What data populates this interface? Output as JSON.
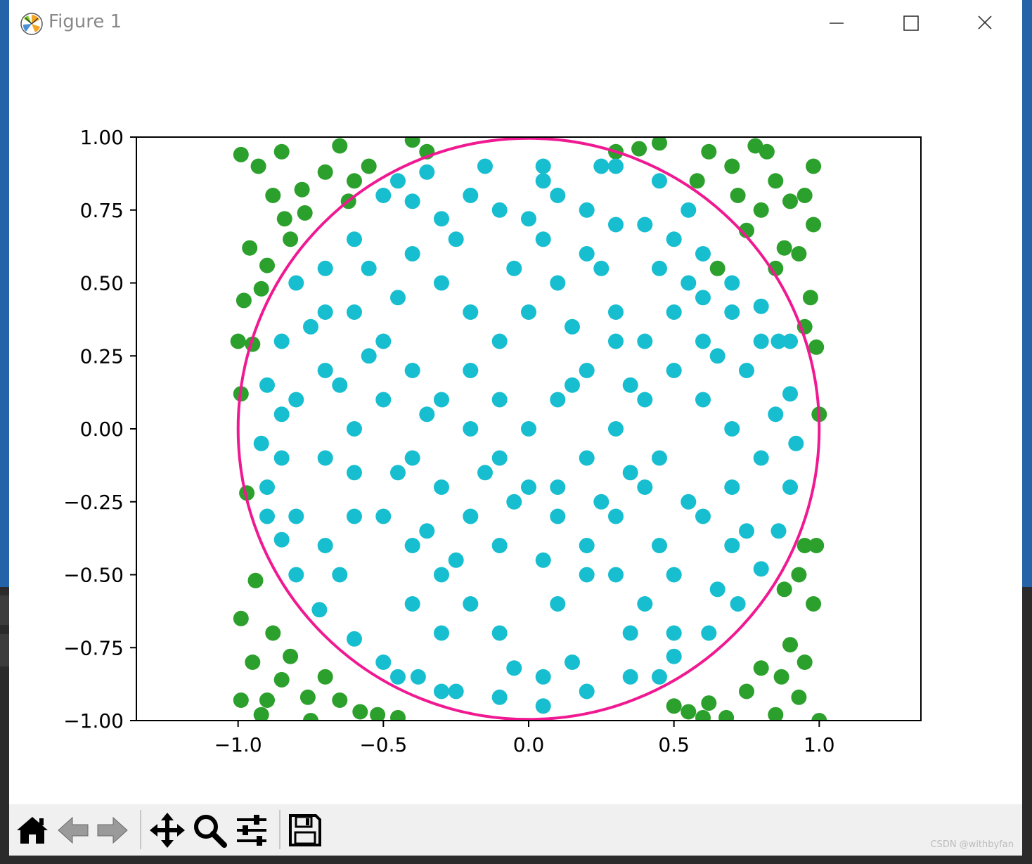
{
  "window": {
    "title": "Figure 1"
  },
  "toolbar": {
    "buttons": [
      {
        "name": "home-button",
        "icon": "home-icon"
      },
      {
        "name": "back-button",
        "icon": "arrow-left-icon"
      },
      {
        "name": "forward-button",
        "icon": "arrow-right-icon"
      },
      {
        "name": "pan-button",
        "icon": "move-icon"
      },
      {
        "name": "zoom-button",
        "icon": "magnifier-icon"
      },
      {
        "name": "configure-subplots-button",
        "icon": "sliders-icon"
      },
      {
        "name": "save-button",
        "icon": "floppy-disk-icon"
      }
    ]
  },
  "watermark": "CSDN @withbyfan",
  "colors": {
    "inside": "#17becf",
    "outside": "#2ca02c",
    "circle": "#f01991",
    "title_bar_text": "#888888",
    "toolbar_bg": "#f0f0f0"
  },
  "chart_data": {
    "type": "scatter",
    "title": "",
    "xlabel": "",
    "ylabel": "",
    "xlim": [
      -1.35,
      1.35
    ],
    "ylim": [
      -1.0,
      1.0
    ],
    "xticks": [
      -1.0,
      -0.5,
      0.0,
      0.5,
      1.0
    ],
    "xtick_labels": [
      "−1.0",
      "−0.5",
      "0.0",
      "0.5",
      "1.0"
    ],
    "yticks": [
      1.0,
      0.75,
      0.5,
      0.25,
      0.0,
      -0.25,
      -0.5,
      -0.75,
      -1.0
    ],
    "ytick_labels": [
      "1.00",
      "0.75",
      "0.50",
      "0.25",
      "0.00",
      "−0.25",
      "−0.50",
      "−0.75",
      "−1.00"
    ],
    "grid": false,
    "circle": {
      "center": [
        0,
        0
      ],
      "radius": 1.0,
      "color": "#f01991"
    },
    "series": [
      {
        "color": "#2ca02c",
        "points": [
          [
            -0.99,
            0.94
          ],
          [
            -0.93,
            0.9
          ],
          [
            -0.85,
            0.95
          ],
          [
            -0.78,
            0.82
          ],
          [
            -0.96,
            0.62
          ],
          [
            -0.9,
            0.56
          ],
          [
            -0.82,
            0.65
          ],
          [
            -0.98,
            0.44
          ],
          [
            -0.92,
            0.48
          ],
          [
            -1.0,
            0.3
          ],
          [
            -0.95,
            0.29
          ],
          [
            -0.77,
            0.74
          ],
          [
            -0.7,
            0.88
          ],
          [
            -0.65,
            0.97
          ],
          [
            -0.6,
            0.85
          ],
          [
            -0.88,
            0.8
          ],
          [
            -0.84,
            0.72
          ],
          [
            -0.99,
            0.12
          ],
          [
            -0.97,
            -0.22
          ],
          [
            -0.94,
            -0.52
          ],
          [
            -0.99,
            -0.65
          ],
          [
            -0.95,
            -0.8
          ],
          [
            -0.88,
            -0.7
          ],
          [
            -0.85,
            -0.86
          ],
          [
            -0.9,
            -0.93
          ],
          [
            -0.82,
            -0.78
          ],
          [
            -0.76,
            -0.92
          ],
          [
            -0.7,
            -0.85
          ],
          [
            -0.65,
            -0.93
          ],
          [
            -0.58,
            -0.97
          ],
          [
            -0.99,
            -0.93
          ],
          [
            -0.92,
            -0.98
          ],
          [
            -0.75,
            -1.0
          ],
          [
            -0.52,
            -0.98
          ],
          [
            -0.45,
            -0.99
          ],
          [
            0.55,
            -0.97
          ],
          [
            0.62,
            -0.94
          ],
          [
            0.68,
            -0.99
          ],
          [
            0.75,
            -0.9
          ],
          [
            0.8,
            -0.82
          ],
          [
            0.87,
            -0.85
          ],
          [
            0.9,
            -0.74
          ],
          [
            0.95,
            -0.8
          ],
          [
            0.98,
            -0.6
          ],
          [
            0.93,
            -0.5
          ],
          [
            0.95,
            -0.4
          ],
          [
            0.99,
            -0.4
          ],
          [
            0.88,
            -0.55
          ],
          [
            0.85,
            -0.98
          ],
          [
            0.93,
            -0.92
          ],
          [
            1.0,
            -1.0
          ],
          [
            0.58,
            0.85
          ],
          [
            0.62,
            0.95
          ],
          [
            0.7,
            0.9
          ],
          [
            0.78,
            0.97
          ],
          [
            0.85,
            0.85
          ],
          [
            0.9,
            0.78
          ],
          [
            0.95,
            0.8
          ],
          [
            0.98,
            0.7
          ],
          [
            0.93,
            0.6
          ],
          [
            0.97,
            0.45
          ],
          [
            0.99,
            0.28
          ],
          [
            0.95,
            0.35
          ],
          [
            0.85,
            0.55
          ],
          [
            0.88,
            0.62
          ],
          [
            0.8,
            0.75
          ],
          [
            0.75,
            0.68
          ],
          [
            1.0,
            0.05
          ],
          [
            0.45,
            0.98
          ],
          [
            0.38,
            0.96
          ],
          [
            0.3,
            0.95
          ],
          [
            -0.35,
            0.95
          ],
          [
            -0.4,
            0.99
          ],
          [
            0.82,
            0.95
          ],
          [
            0.98,
            0.9
          ],
          [
            -0.55,
            0.9
          ],
          [
            -0.62,
            0.78
          ],
          [
            0.65,
            0.55
          ],
          [
            0.72,
            0.8
          ],
          [
            0.6,
            -0.99
          ],
          [
            0.5,
            -0.95
          ]
        ]
      },
      {
        "color": "#17becf",
        "points": [
          [
            -0.5,
            0.8
          ],
          [
            -0.4,
            0.78
          ],
          [
            -0.3,
            0.72
          ],
          [
            -0.2,
            0.8
          ],
          [
            -0.1,
            0.75
          ],
          [
            0.0,
            0.72
          ],
          [
            0.1,
            0.8
          ],
          [
            0.2,
            0.75
          ],
          [
            0.3,
            0.7
          ],
          [
            0.4,
            0.7
          ],
          [
            0.5,
            0.65
          ],
          [
            0.6,
            0.6
          ],
          [
            0.7,
            0.5
          ],
          [
            -0.6,
            0.65
          ],
          [
            -0.7,
            0.55
          ],
          [
            -0.8,
            0.5
          ],
          [
            -0.85,
            0.3
          ],
          [
            -0.9,
            0.15
          ],
          [
            -0.92,
            -0.05
          ],
          [
            -0.9,
            -0.2
          ],
          [
            -0.85,
            -0.38
          ],
          [
            -0.8,
            -0.5
          ],
          [
            -0.72,
            -0.62
          ],
          [
            -0.6,
            -0.72
          ],
          [
            -0.5,
            -0.8
          ],
          [
            -0.38,
            -0.85
          ],
          [
            -0.25,
            -0.9
          ],
          [
            -0.1,
            -0.92
          ],
          [
            0.05,
            -0.95
          ],
          [
            0.2,
            -0.9
          ],
          [
            0.35,
            -0.85
          ],
          [
            0.5,
            -0.78
          ],
          [
            0.62,
            -0.7
          ],
          [
            0.72,
            -0.6
          ],
          [
            0.8,
            -0.48
          ],
          [
            0.86,
            -0.35
          ],
          [
            0.9,
            -0.2
          ],
          [
            0.92,
            -0.05
          ],
          [
            0.9,
            0.12
          ],
          [
            0.86,
            0.3
          ],
          [
            0.8,
            0.42
          ],
          [
            -0.6,
            0.4
          ],
          [
            -0.5,
            0.3
          ],
          [
            -0.4,
            0.2
          ],
          [
            -0.3,
            0.1
          ],
          [
            -0.2,
            0.0
          ],
          [
            -0.1,
            -0.1
          ],
          [
            0.0,
            -0.2
          ],
          [
            0.1,
            -0.3
          ],
          [
            0.2,
            -0.4
          ],
          [
            0.3,
            -0.5
          ],
          [
            0.4,
            -0.6
          ],
          [
            0.5,
            -0.7
          ],
          [
            0.6,
            0.3
          ],
          [
            0.5,
            0.2
          ],
          [
            0.4,
            0.1
          ],
          [
            0.3,
            0.0
          ],
          [
            0.2,
            -0.1
          ],
          [
            0.1,
            -0.2
          ],
          [
            -0.1,
            0.3
          ],
          [
            -0.2,
            0.4
          ],
          [
            -0.3,
            0.5
          ],
          [
            -0.4,
            0.6
          ],
          [
            -0.5,
            -0.3
          ],
          [
            -0.4,
            -0.4
          ],
          [
            -0.3,
            -0.5
          ],
          [
            -0.2,
            -0.6
          ],
          [
            -0.1,
            -0.7
          ],
          [
            0.0,
            0.4
          ],
          [
            0.1,
            0.5
          ],
          [
            0.2,
            0.6
          ],
          [
            0.3,
            0.4
          ],
          [
            0.4,
            0.3
          ],
          [
            0.5,
            0.4
          ],
          [
            0.6,
            0.1
          ],
          [
            0.7,
            0.0
          ],
          [
            0.7,
            -0.2
          ],
          [
            0.6,
            -0.3
          ],
          [
            0.5,
            -0.5
          ],
          [
            -0.7,
            0.2
          ],
          [
            -0.7,
            -0.1
          ],
          [
            -0.6,
            -0.3
          ],
          [
            -0.6,
            0.0
          ],
          [
            -0.5,
            0.1
          ],
          [
            -0.4,
            -0.1
          ],
          [
            -0.3,
            -0.2
          ],
          [
            -0.2,
            0.2
          ],
          [
            -0.1,
            0.1
          ],
          [
            0.0,
            0.0
          ],
          [
            0.1,
            0.1
          ],
          [
            0.2,
            0.2
          ],
          [
            0.3,
            0.3
          ],
          [
            0.4,
            -0.2
          ],
          [
            0.3,
            -0.3
          ],
          [
            0.2,
            -0.5
          ],
          [
            0.1,
            -0.6
          ],
          [
            -0.1,
            -0.4
          ],
          [
            -0.2,
            -0.3
          ],
          [
            -0.3,
            -0.7
          ],
          [
            -0.4,
            -0.6
          ],
          [
            0.45,
            0.55
          ],
          [
            0.55,
            0.75
          ],
          [
            0.25,
            0.9
          ],
          [
            -0.15,
            0.9
          ],
          [
            -0.35,
            0.88
          ],
          [
            0.05,
            0.9
          ],
          [
            -0.75,
            0.35
          ],
          [
            -0.8,
            0.1
          ],
          [
            -0.8,
            -0.3
          ],
          [
            0.75,
            0.2
          ],
          [
            0.8,
            -0.1
          ],
          [
            0.75,
            -0.35
          ],
          [
            -0.55,
            0.55
          ],
          [
            0.15,
            -0.8
          ],
          [
            -0.05,
            -0.82
          ],
          [
            0.35,
            -0.7
          ],
          [
            -0.45,
            -0.15
          ],
          [
            0.45,
            -0.4
          ],
          [
            0.65,
            -0.55
          ],
          [
            -0.65,
            -0.5
          ],
          [
            0.55,
            0.5
          ],
          [
            -0.25,
            0.65
          ],
          [
            0.15,
            0.35
          ],
          [
            -0.05,
            0.55
          ],
          [
            0.25,
            -0.25
          ],
          [
            -0.35,
            0.05
          ],
          [
            0.05,
            -0.45
          ],
          [
            0.35,
            0.15
          ],
          [
            -0.15,
            -0.15
          ],
          [
            0.6,
            0.45
          ],
          [
            -0.6,
            -0.15
          ],
          [
            0.8,
            0.3
          ],
          [
            -0.85,
            -0.1
          ],
          [
            0.05,
            0.65
          ],
          [
            -0.45,
            0.45
          ],
          [
            0.45,
            -0.1
          ],
          [
            -0.25,
            -0.45
          ],
          [
            0.15,
            0.15
          ],
          [
            -0.05,
            -0.25
          ],
          [
            0.55,
            -0.25
          ],
          [
            -0.55,
            0.25
          ],
          [
            0.25,
            0.55
          ],
          [
            -0.35,
            -0.35
          ],
          [
            0.35,
            -0.15
          ],
          [
            0.65,
            0.25
          ],
          [
            -0.65,
            0.15
          ],
          [
            0.85,
            0.05
          ],
          [
            -0.85,
            0.05
          ],
          [
            0.05,
            0.85
          ],
          [
            0.05,
            -0.85
          ],
          [
            -0.7,
            -0.4
          ],
          [
            0.7,
            0.4
          ],
          [
            0.7,
            -0.4
          ],
          [
            -0.7,
            0.4
          ],
          [
            0.45,
            0.85
          ],
          [
            -0.45,
            -0.85
          ],
          [
            0.45,
            -0.85
          ],
          [
            -0.45,
            0.85
          ],
          [
            0.9,
            0.3
          ],
          [
            -0.9,
            -0.3
          ],
          [
            0.3,
            0.9
          ],
          [
            -0.3,
            -0.9
          ]
        ]
      }
    ]
  }
}
